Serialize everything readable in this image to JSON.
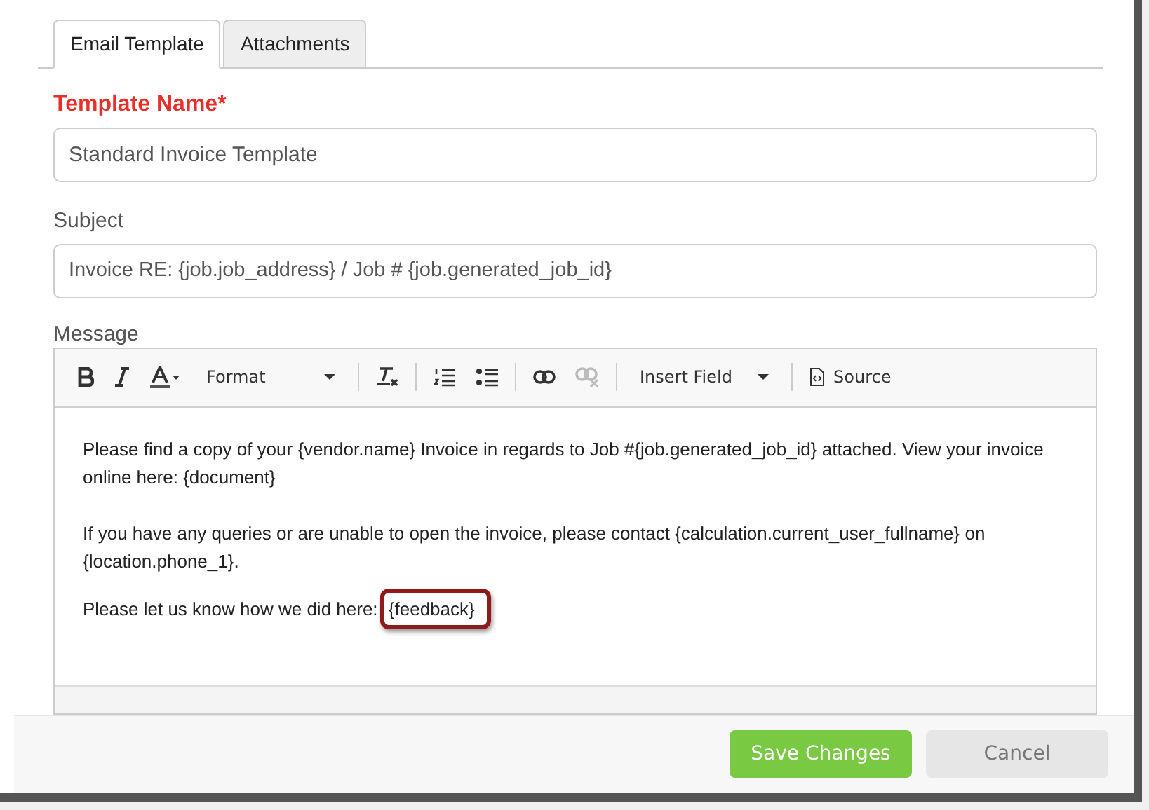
{
  "tabs": [
    {
      "label": "Email Template",
      "selected": true
    },
    {
      "label": "Attachments",
      "selected": false
    }
  ],
  "template_name": {
    "label": "Template Name*",
    "required": true,
    "value": "Standard Invoice Template"
  },
  "subject": {
    "label": "Subject",
    "value": "Invoice RE: {job.job_address} / Job # {job.generated_job_id}"
  },
  "message": {
    "label": "Message",
    "toolbar": [
      {
        "kind": "bold",
        "disabled": false
      },
      {
        "kind": "italic",
        "disabled": false
      },
      {
        "kind": "color",
        "disabled": false
      },
      {
        "kind": "dropdown",
        "label": "Format",
        "disabled": false
      },
      {
        "kind": "separator"
      },
      {
        "kind": "clear",
        "disabled": false
      },
      {
        "kind": "separator"
      },
      {
        "kind": "numbered",
        "disabled": false
      },
      {
        "kind": "bulleted",
        "disabled": false
      },
      {
        "kind": "separator"
      },
      {
        "kind": "link",
        "disabled": false
      },
      {
        "kind": "unlink",
        "disabled": true
      },
      {
        "kind": "separator"
      },
      {
        "kind": "dropdown",
        "label": "Insert Field",
        "disabled": false
      },
      {
        "kind": "separator"
      },
      {
        "kind": "source",
        "label": "Source",
        "disabled": false
      }
    ],
    "paragraphs": [
      {
        "text": "Please find a copy of your {vendor.name} Invoice in regards to Job #{job.generated_job_id} attached. View your invoice online here: {document}"
      },
      {
        "text": "If you have any queries or are unable to open the invoice, please contact {calculation.current_user_fullname} on {location.phone_1}."
      },
      {
        "text": "Please let us know how we did here: ",
        "highlighted": "{feedback}"
      }
    ]
  },
  "buttons": [
    {
      "kind": "primary",
      "label": "Save Changes"
    },
    {
      "kind": "secondary",
      "label": "Cancel"
    }
  ]
}
